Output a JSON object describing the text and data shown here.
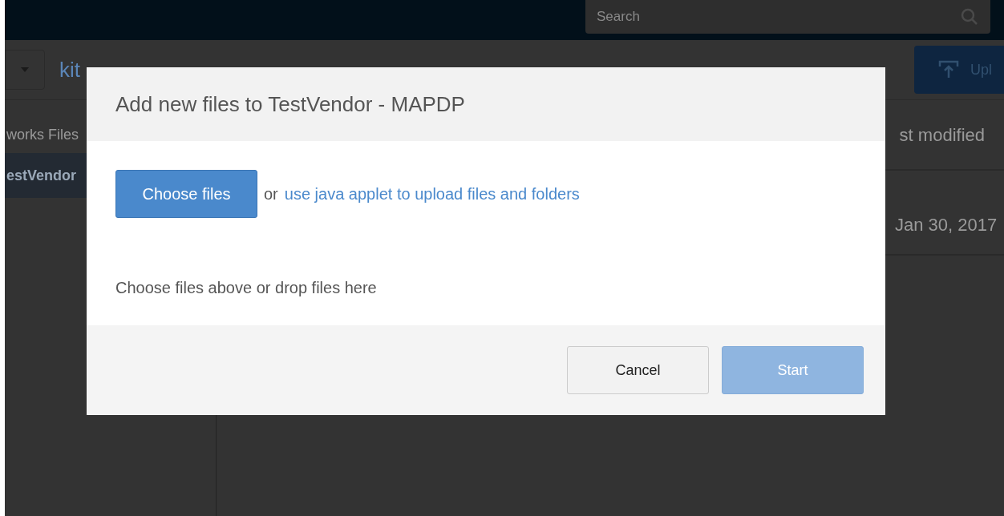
{
  "top_bar": {
    "search": {
      "placeholder": "Search"
    }
  },
  "breadcrumb": {
    "text": "kit"
  },
  "upload_button": {
    "label": "Upl"
  },
  "sidebar": {
    "items": [
      {
        "label": "works Files",
        "selected": false
      },
      {
        "label": "estVendor",
        "selected": true
      }
    ]
  },
  "table": {
    "columns": [
      "st modified"
    ],
    "rows": [
      [
        "Jan 30, 2017"
      ]
    ]
  },
  "dialog": {
    "title": "Add new files to TestVendor - MAPDP",
    "choose_button": "Choose files",
    "or_text": "or",
    "applet_link": "use java applet to upload files and folders",
    "drop_hint": "Choose files above or drop files here",
    "buttons": [
      {
        "label": "Cancel",
        "disabled": false,
        "kind": "default"
      },
      {
        "label": "Start",
        "disabled": true,
        "kind": "primary"
      }
    ]
  }
}
